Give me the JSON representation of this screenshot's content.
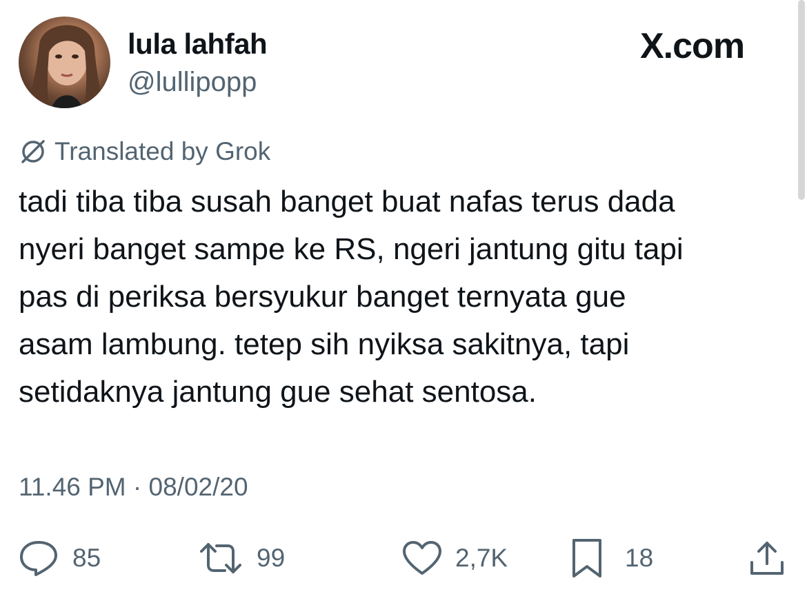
{
  "author": {
    "name": "lula lahfah",
    "handle": "@lullipopp"
  },
  "brand": {
    "label": "X.com"
  },
  "translation": {
    "label": "Translated by Grok",
    "icon": "translate-icon"
  },
  "tweet": {
    "lines": [
      "tadi tiba tiba susah banget buat nafas terus dada",
      "nyeri banget sampe ke RS, ngeri jantung gitu tapi",
      "pas di periksa bersyukur banget ternyata gue",
      "asam lambung. tetep sih nyiksa sakitnya, tapi",
      "setidaknya jantung gue sehat sentosa."
    ],
    "timestamp": "11.46 PM · 08/02/20"
  },
  "actions": {
    "reply": {
      "count": "85",
      "icon": "reply-icon"
    },
    "repost": {
      "count": "99",
      "icon": "repost-icon"
    },
    "like": {
      "count": "2,7K",
      "icon": "heart-icon"
    },
    "bookmark": {
      "count": "18",
      "icon": "bookmark-icon"
    },
    "share": {
      "icon": "share-icon"
    }
  },
  "colors": {
    "text": "#0f1419",
    "secondary": "#536471",
    "background": "#ffffff"
  }
}
